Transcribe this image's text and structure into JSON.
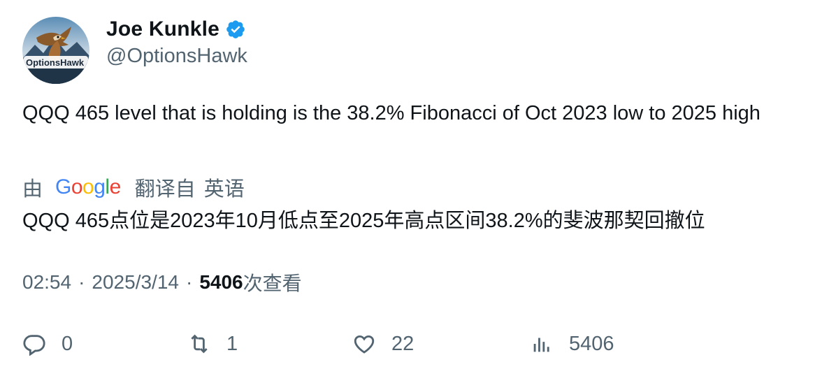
{
  "author": {
    "name": "Joe Kunkle",
    "handle": "@OptionsHawk",
    "avatar_logo_text": "OptionsHawk"
  },
  "tweet": {
    "text": "QQQ 465 level that is holding is the 38.2% Fibonacci of Oct 2023 low to 2025 high"
  },
  "translation": {
    "by_label": "由",
    "provider": "Google",
    "from_label": "翻译自",
    "source_language": "英语",
    "text": "QQQ 465点位是2023年10月低点至2025年高点区间38.2%的斐波那契回撤位"
  },
  "meta": {
    "time": "02:54",
    "separator": "·",
    "date": "2025/3/14",
    "views_count": "5406",
    "views_label": "次查看"
  },
  "actions": {
    "replies": "0",
    "retweets": "1",
    "likes": "22",
    "views": "5406"
  },
  "colors": {
    "text_primary": "#0f1419",
    "text_secondary": "#536471",
    "verified_blue": "#1d9bf0"
  },
  "icons": [
    "verified-badge-icon",
    "reply-icon",
    "retweet-icon",
    "like-icon",
    "views-icon"
  ]
}
